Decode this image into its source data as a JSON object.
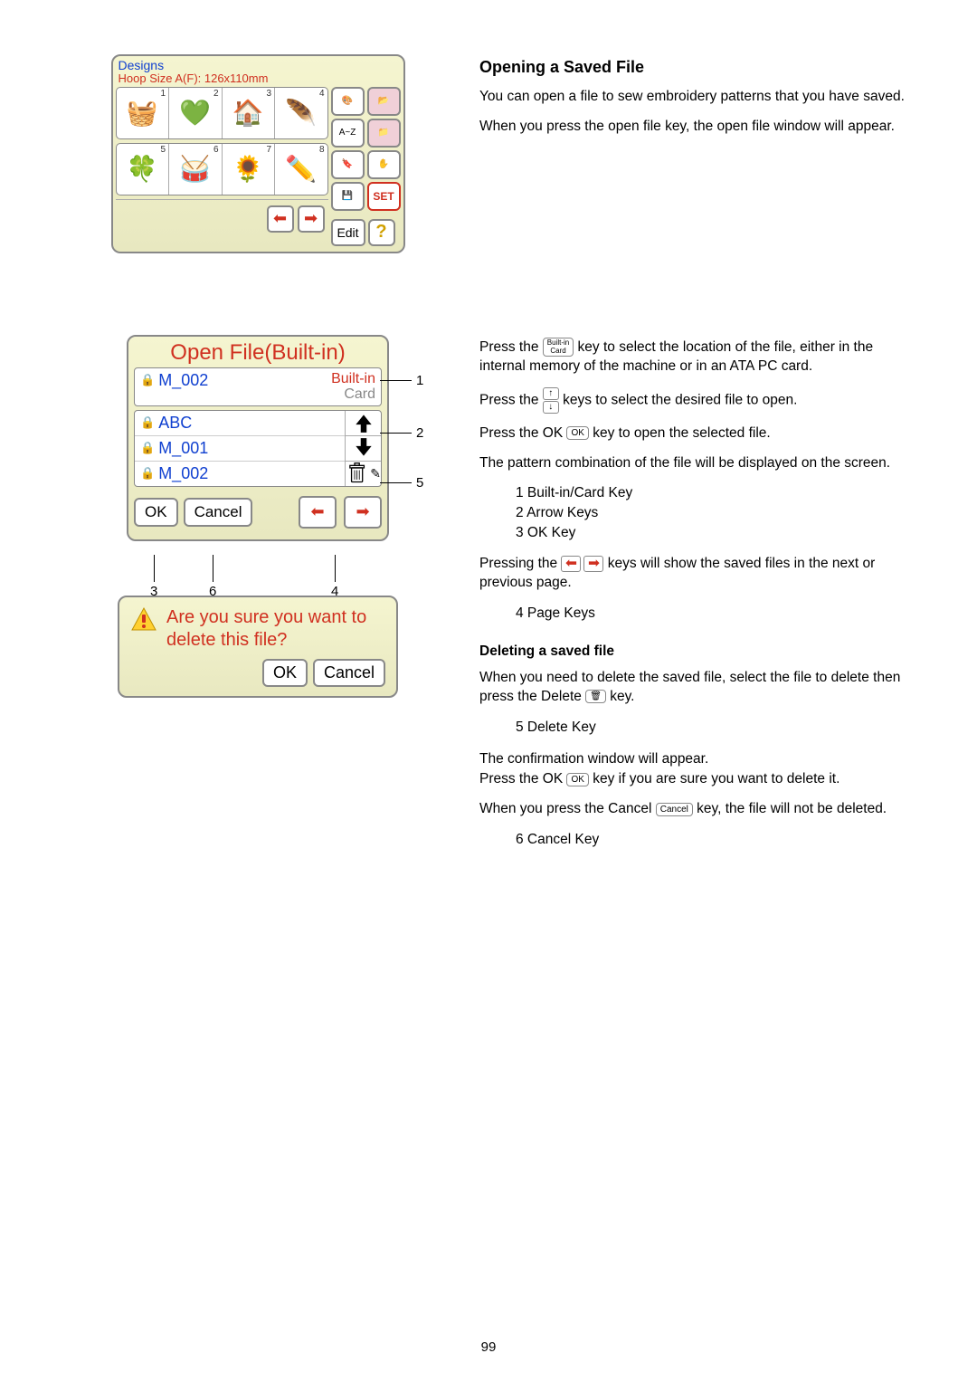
{
  "designs": {
    "title": "Designs",
    "hoop": "Hoop Size A(F): 126x110mm",
    "cells": [
      "1",
      "2",
      "3",
      "4",
      "5",
      "6",
      "7",
      "8"
    ],
    "emoji": [
      "🧺",
      "💚",
      "🏠",
      "🪶",
      "🍀",
      "🥁",
      "🌻",
      "✏️"
    ],
    "az": "A~Z",
    "set": "SET",
    "edit": "Edit"
  },
  "openfile": {
    "title": "Open File(Built-in)",
    "selected": "M_002",
    "toggle_builtin": "Built-in",
    "toggle_card": "Card",
    "items": [
      "ABC",
      "M_001",
      "M_002"
    ],
    "ok": "OK",
    "cancel": "Cancel",
    "callouts": {
      "c1": "1",
      "c2": "2",
      "c3": "3",
      "c4": "4",
      "c5": "5",
      "c6": "6"
    }
  },
  "confirm": {
    "text": "Are you sure you want to delete this file?",
    "ok": "OK",
    "cancel": "Cancel"
  },
  "right": {
    "h1": "Opening a Saved File",
    "p1": "You can open a file to sew embroidery patterns that you have saved.",
    "p2": "When you press the open file key, the open file window will appear.",
    "p3a": "Press the ",
    "p3b": " key to select the location of the file, either in the internal memory of the machine or in an ATA PC card.",
    "p4a": "Press the ",
    "p4b": " keys to select the desired file to open.",
    "p5a": "Press the OK ",
    "p5b": " key to open the selected file.",
    "p6": "The pattern combination of the file will be displayed on the screen.",
    "kl1_1": "1  Built-in/Card Key",
    "kl1_2": "2  Arrow Keys",
    "kl1_3": "3  OK Key",
    "p7a": "Pressing the ",
    "p7b": " keys will show the saved files in the next or previous page.",
    "kl2": "4  Page Keys",
    "sub": "Deleting a saved file",
    "p8a": "When you need to delete the saved file, select the file to delete then press the Delete ",
    "p8b": " key.",
    "kl3": "5  Delete Key",
    "p9": "The confirmation window will appear.",
    "p10a": "Press the OK ",
    "p10b": " key if you are sure you want to delete it.",
    "p11a": "When you press the Cancel ",
    "p11b": " key, the file will not be deleted.",
    "kl4": "6  Cancel Key",
    "inline_builtin_card": "Built-in\nCard",
    "inline_ok": "OK",
    "inline_cancel": "Cancel"
  },
  "page_num": "99"
}
